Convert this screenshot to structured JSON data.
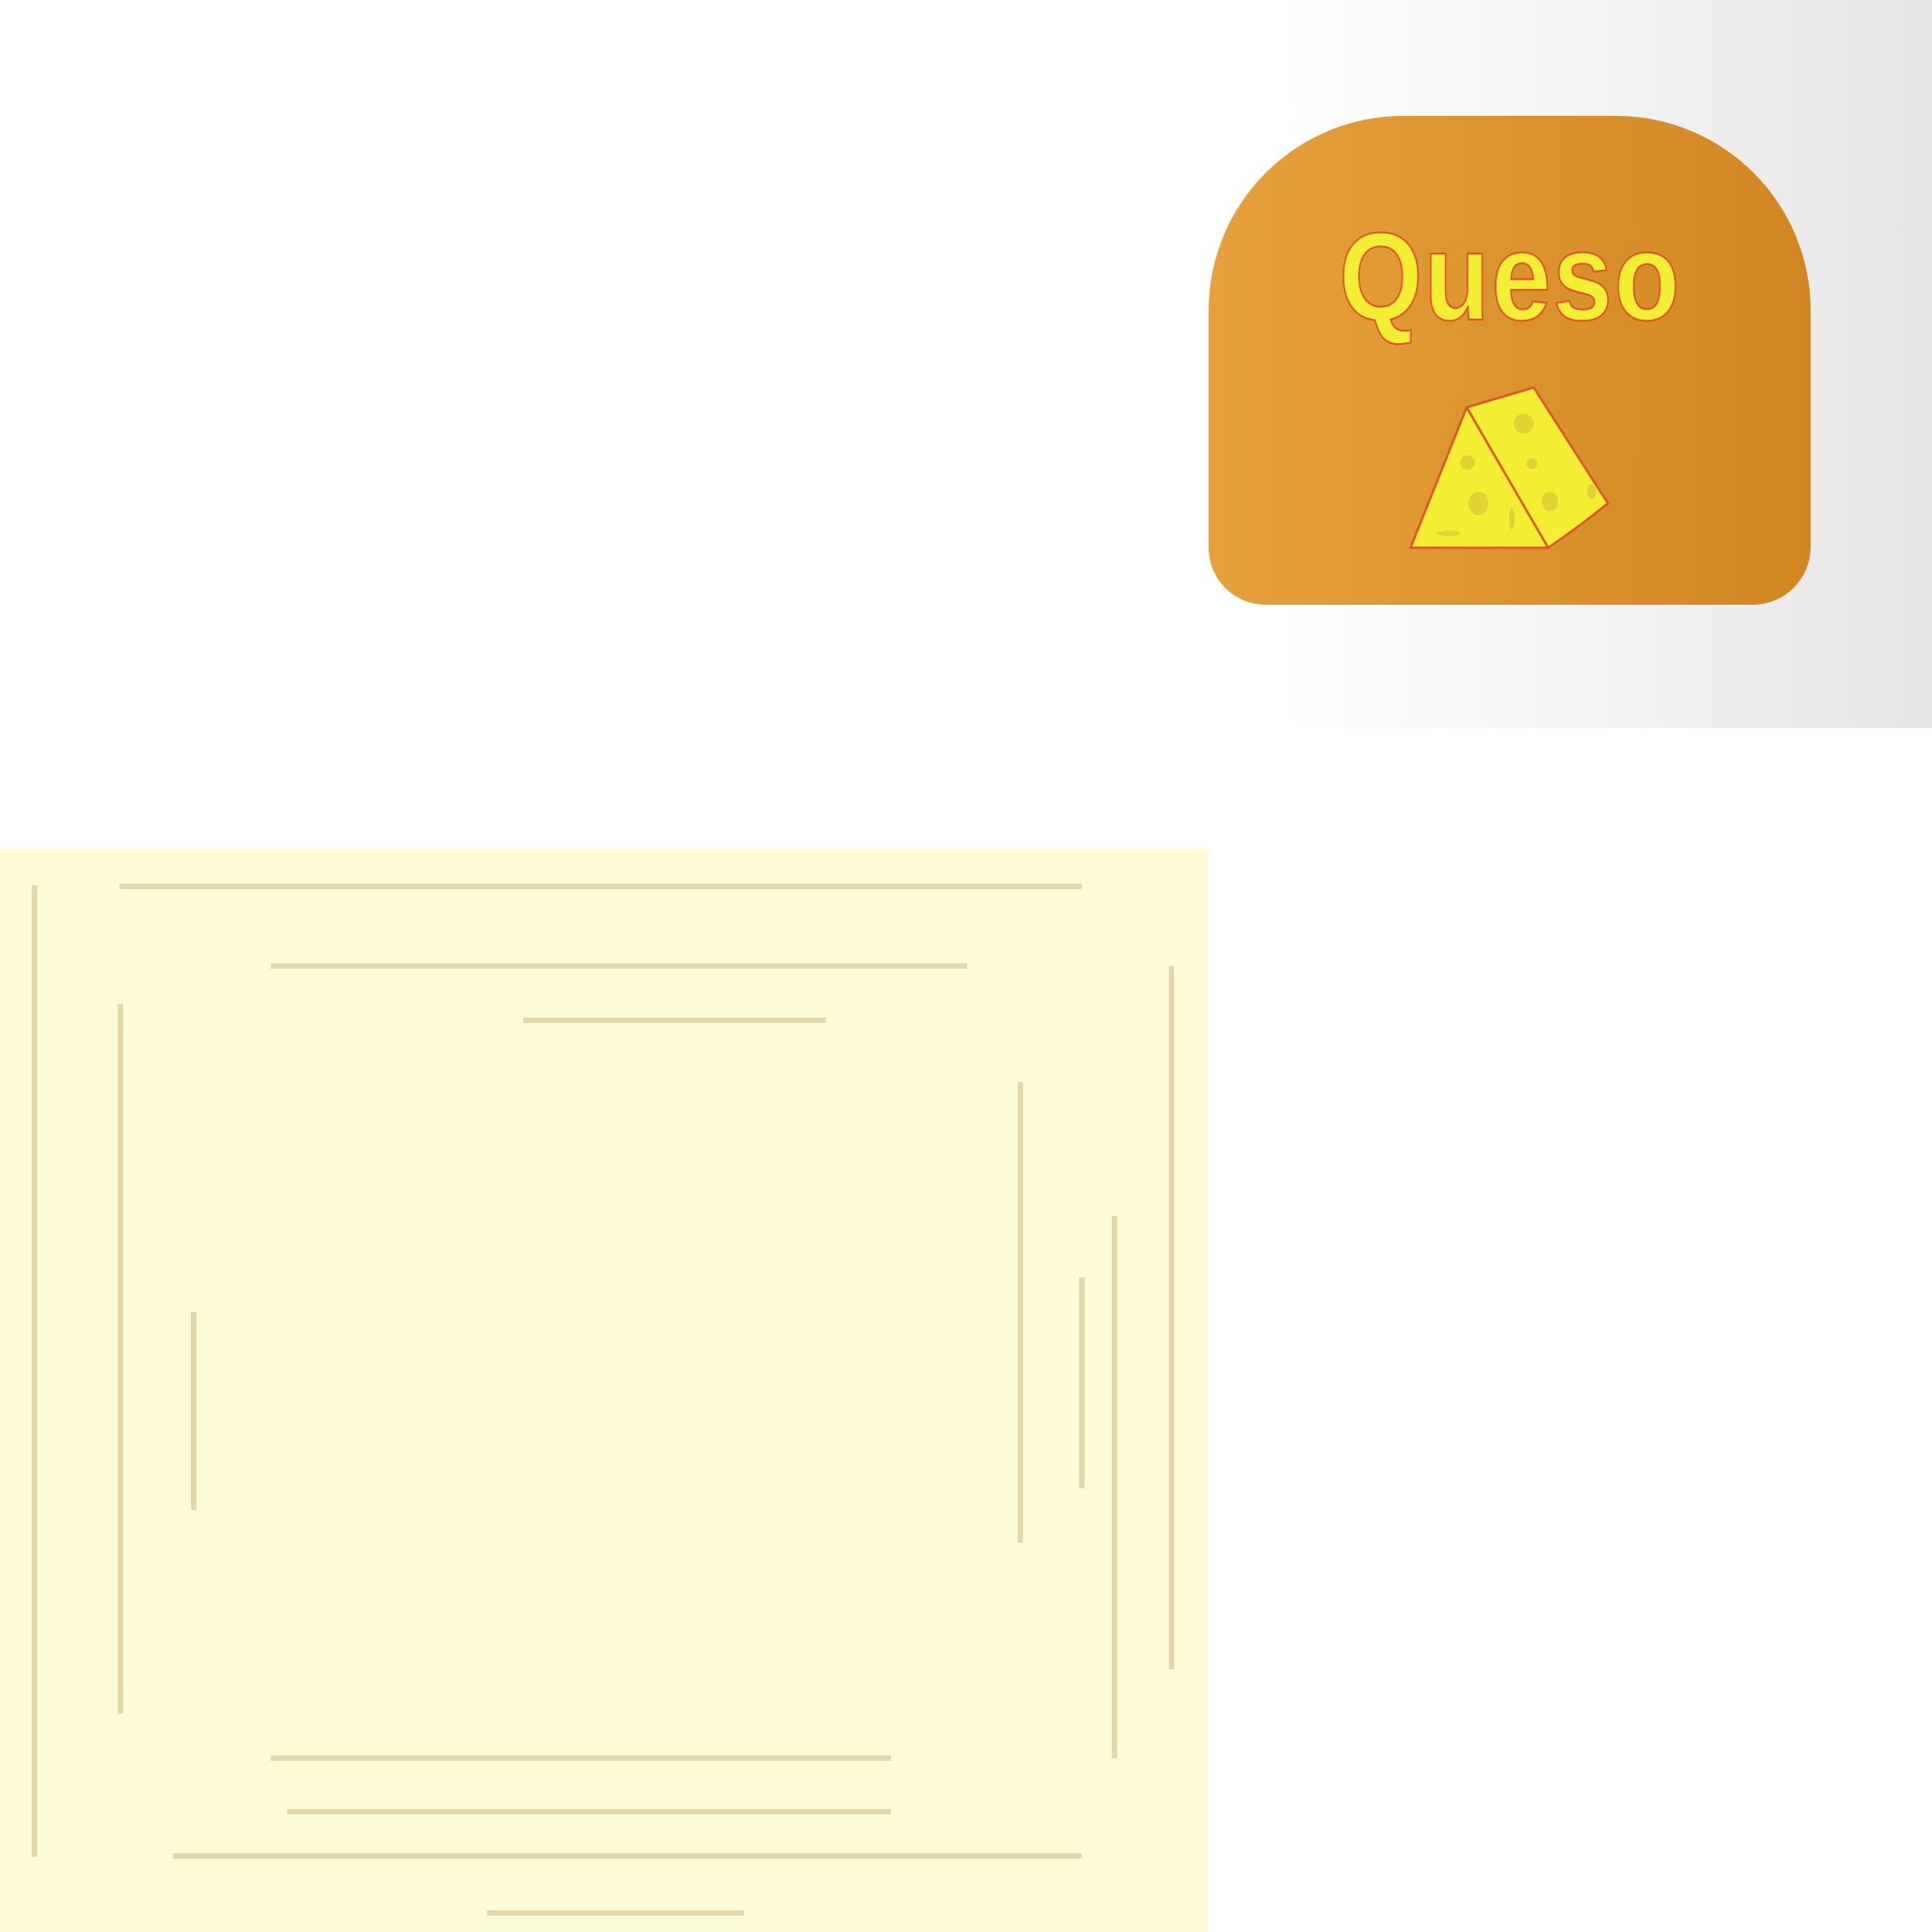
{
  "label": {
    "title": "Queso"
  },
  "icons": {
    "label_icon": "cheese-wedge-icon"
  },
  "colors": {
    "page_background": "#ffffff",
    "shadow_gradient_start": "#ffffff",
    "shadow_gradient_end": "#e6e6e6",
    "label_gradient_start": "#e7a13c",
    "label_gradient_end": "#d18622",
    "title_fill": "#f5ef34",
    "title_stroke": "#e0532c",
    "cheese_fill": "#f5ef34",
    "cheese_stroke": "#e0532c",
    "cheese_holes": "#e2d335",
    "mat_background": "#fdfad7",
    "mat_lines": "#e3d7ae"
  }
}
